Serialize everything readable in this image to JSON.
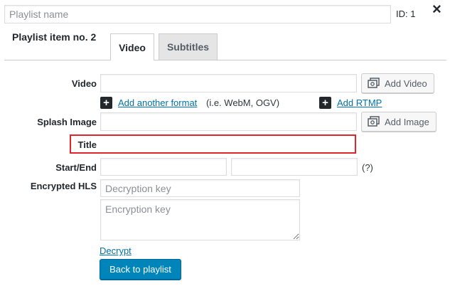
{
  "header": {
    "playlist_name_placeholder": "Playlist name",
    "playlist_name_value": "",
    "id_label": "ID: 1",
    "close_symbol": "×",
    "item_title": "Playlist item no. 2"
  },
  "tabs": [
    {
      "label": "Video",
      "active": true
    },
    {
      "label": "Subtitles",
      "active": false
    }
  ],
  "form": {
    "video_label": "Video",
    "video_value": "",
    "add_video_label": "Add Video",
    "add_format_link": "Add another format",
    "add_format_hint": "(i.e. WebM, OGV)",
    "add_rtmp_link": "Add RTMP",
    "splash_label": "Splash Image",
    "splash_value": "",
    "add_image_label": "Add Image",
    "title_label": "Title",
    "title_value": "",
    "start_end_label": "Start/End",
    "start_value": "",
    "end_value": "",
    "start_end_help": "(?)",
    "hls_label": "Encrypted HLS",
    "decryption_placeholder": "Decryption key",
    "encryption_placeholder": "Encryption key",
    "decrypt_link": "Decrypt",
    "back_button": "Back to playlist"
  },
  "colors": {
    "highlight_border": "#e0252b",
    "primary_button": "#0085ba",
    "link": "#0073aa"
  },
  "icons": {
    "close": "close-icon",
    "media": "media-icon",
    "plus": "plus-icon"
  }
}
